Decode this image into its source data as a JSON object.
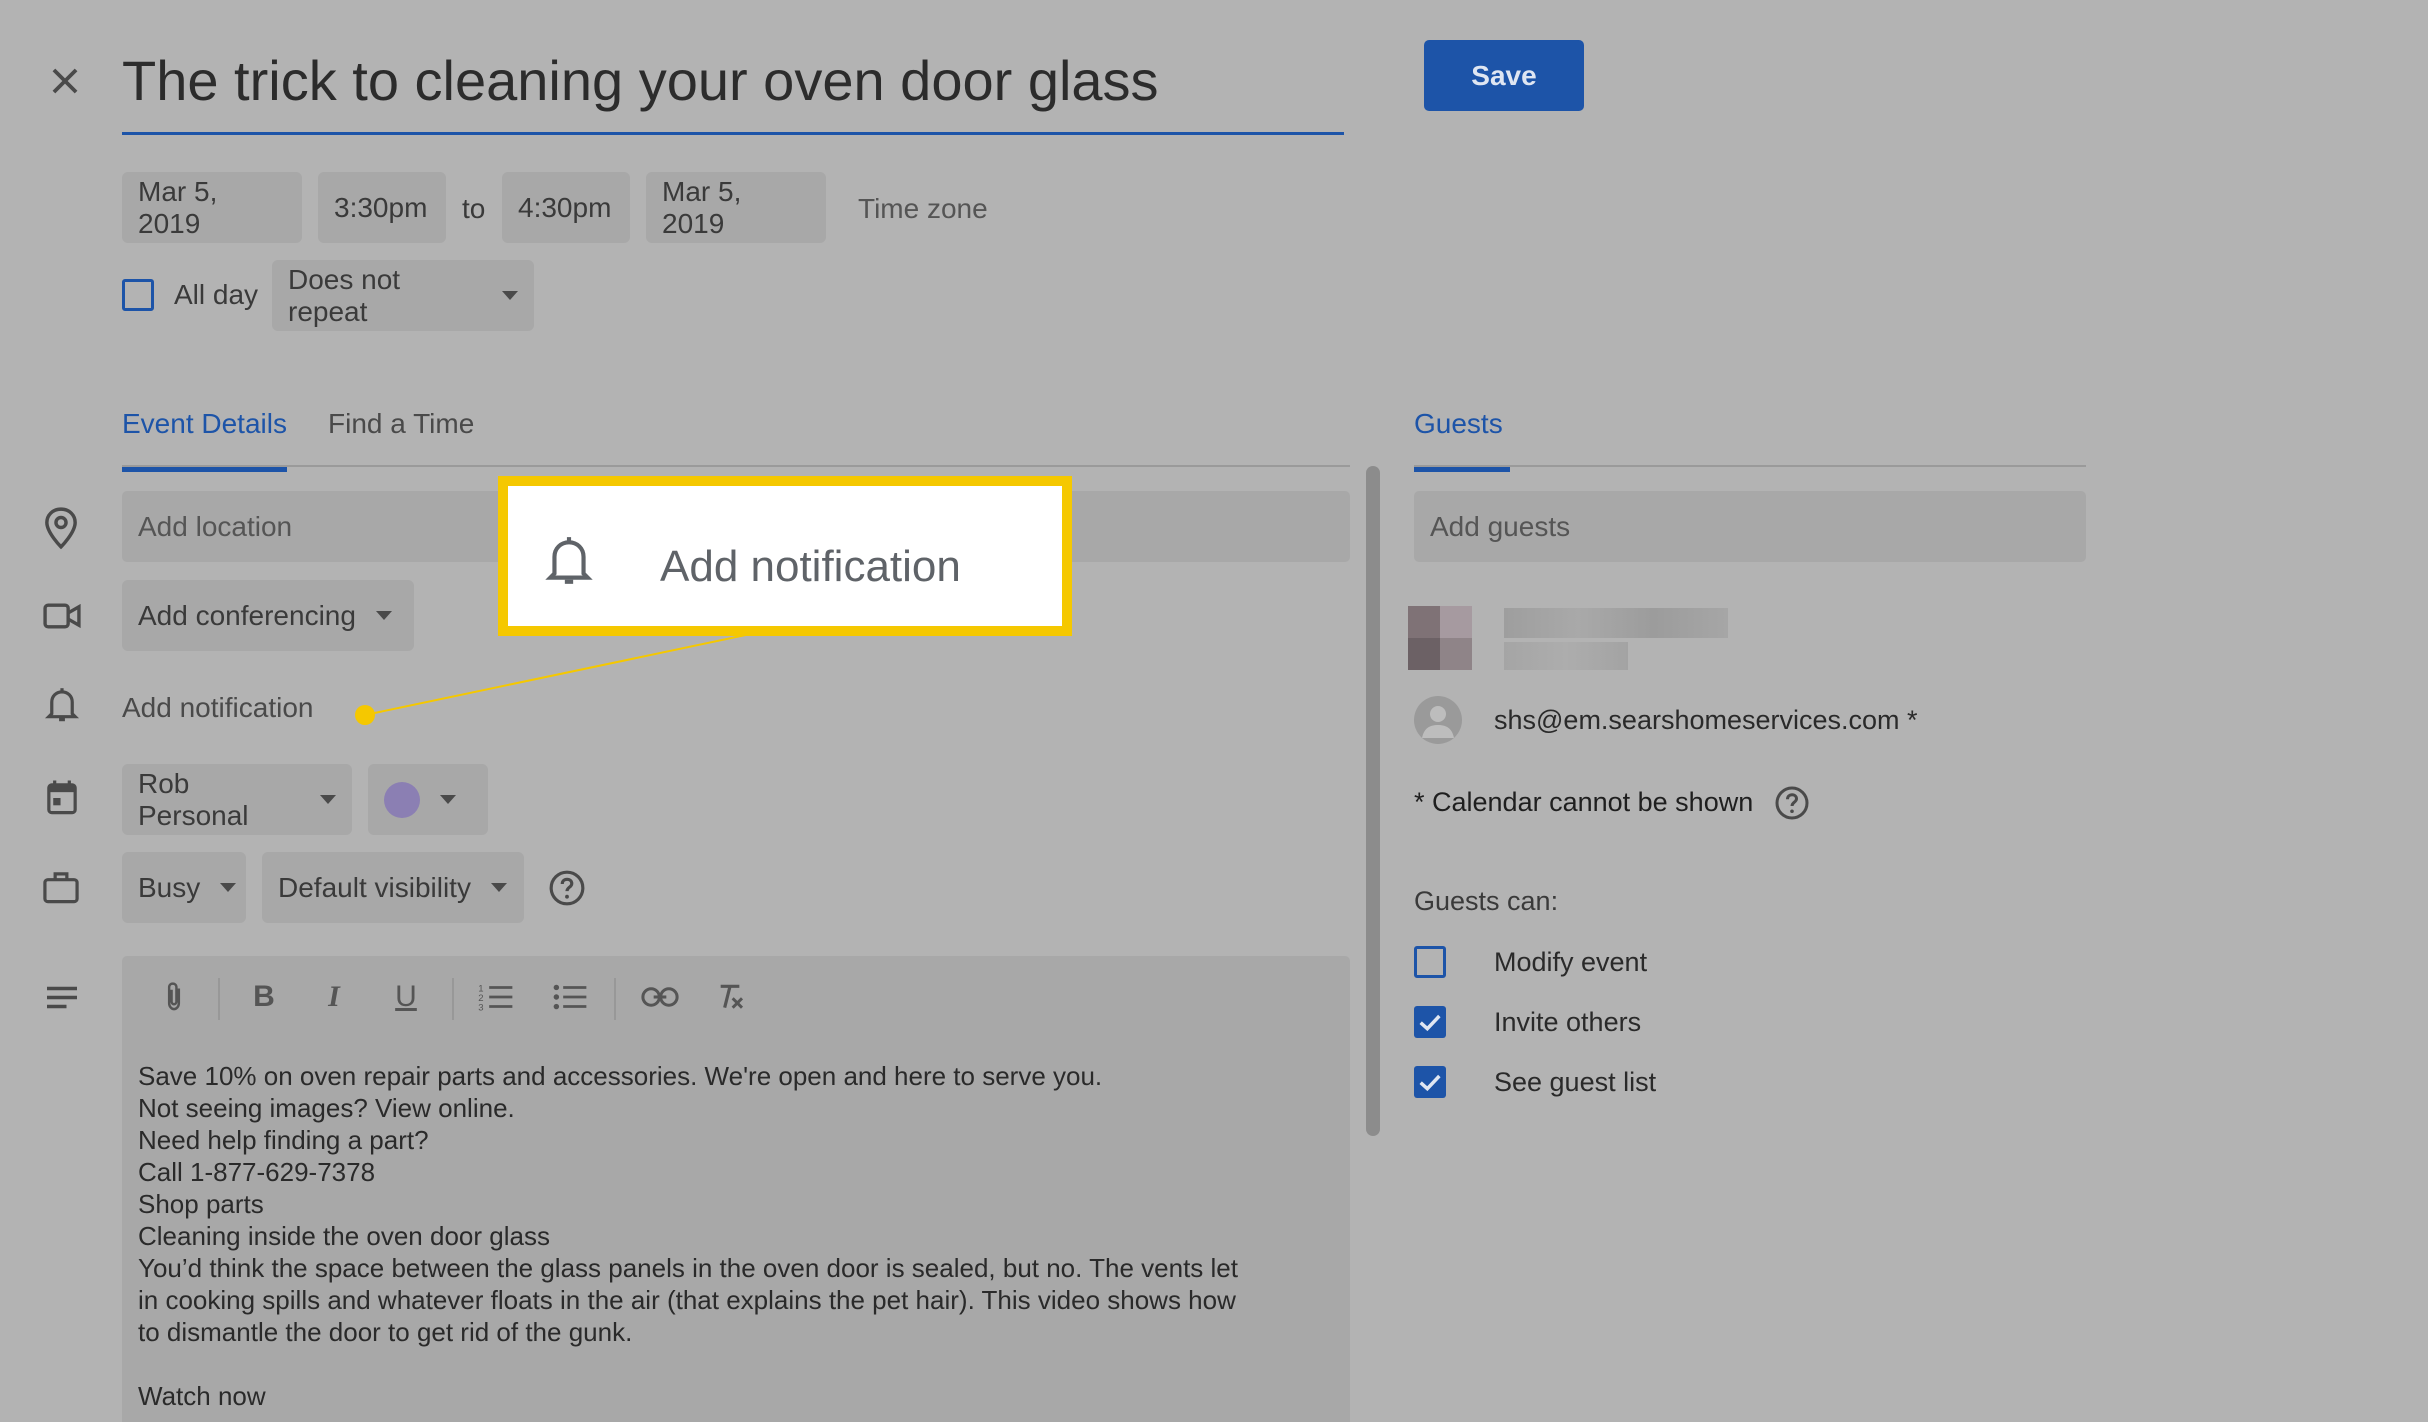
{
  "header": {
    "title": "The trick to cleaning your oven door glass",
    "save_label": "Save"
  },
  "datetime": {
    "start_date": "Mar 5, 2019",
    "start_time": "3:30pm",
    "to_label": "to",
    "end_time": "4:30pm",
    "end_date": "Mar 5, 2019",
    "timezone_label": "Time zone",
    "all_day_label": "All day",
    "repeat_value": "Does not repeat"
  },
  "tabs": {
    "event_details": "Event Details",
    "find_time": "Find a Time",
    "guests": "Guests"
  },
  "details": {
    "location_placeholder": "Add location",
    "conferencing": "Add conferencing",
    "notification": "Add notification",
    "calendar": "Rob Personal",
    "color": "#8b7fb3",
    "status": "Busy",
    "visibility": "Default visibility"
  },
  "callout": {
    "text": "Add notification",
    "border_color": "#f5c800"
  },
  "description": {
    "lines": [
      "Save 10% on oven repair parts and accessories. We're open and here to serve you.",
      "Not seeing images? View online.",
      "Need help finding a part?",
      "Call 1-877-629-7378",
      "Shop parts",
      "Cleaning inside the oven door glass",
      "You’d think the space between the glass panels in the oven door is sealed, but no. The vents let",
      "in cooking spills and whatever floats in the air (that explains the pet hair). This video shows how",
      "to dismantle the door to get rid of the gunk.",
      "",
      "Watch now"
    ]
  },
  "guests": {
    "add_placeholder": "Add guests",
    "guest_email": "shs@em.searshomeservices.com *",
    "calendar_note": "* Calendar cannot be shown",
    "permissions_title": "Guests can:",
    "permissions": [
      {
        "label": "Modify event",
        "checked": false
      },
      {
        "label": "Invite others",
        "checked": true
      },
      {
        "label": "See guest list",
        "checked": true
      }
    ]
  },
  "colors": {
    "accent": "#1d54a8",
    "background": "#b3b3b3",
    "field": "#a8a8a8"
  }
}
